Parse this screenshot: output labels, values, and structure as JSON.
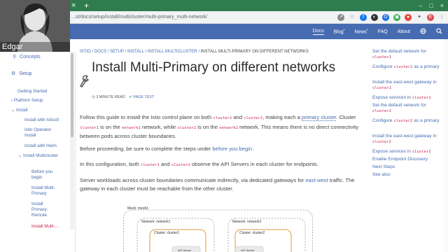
{
  "browser": {
    "url": "...st/docs/setup/install/multicluster/multi-primary_multi-network/",
    "tab_close": "×",
    "tab_new": "+",
    "window_controls": [
      "–",
      "□",
      "×"
    ]
  },
  "webcam": {
    "name": "Edgar"
  },
  "header": {
    "nav": [
      {
        "label": "Docs",
        "active": true
      },
      {
        "label": "Blog",
        "sup": "•"
      },
      {
        "label": "News",
        "sup": "•"
      },
      {
        "label": "FAQ"
      },
      {
        "label": "About"
      }
    ],
    "icons": [
      "globe-icon",
      "search-icon"
    ]
  },
  "sidebar": {
    "concepts": "Concepts",
    "setup": "Setup",
    "items": [
      "Getting Started",
      "Platform Setup",
      "Install",
      "Install with Istioctl",
      "Istio Operator Install",
      "Install with Helm",
      "Install Multicluster",
      "Before you begin",
      "Install Multi-Primary",
      "Install Primary-Remote",
      "Install Multi-..."
    ]
  },
  "breadcrumb": {
    "items": [
      "ISTIO",
      "DOCS",
      "SETUP",
      "INSTALL",
      "INSTALL MULTICLUSTER"
    ],
    "separator": "/",
    "current": "INSTALL MULTI-PRIMARY ON DIFFERENT NETWORKS"
  },
  "page": {
    "title": "Install Multi-Primary on different networks",
    "read_time": "3 MINUTE READ",
    "page_test": "PAGE TEST",
    "p1": {
      "a": "Follow this guide to install the Istio control plane on both ",
      "c1": "cluster1",
      "b": " and ",
      "c2": "cluster2",
      "c": ", making each a ",
      "link": "primary cluster",
      "d": ". Cluster ",
      "c3": "cluster1",
      "e": " is on the ",
      "c4": "network1",
      "f": " network, while ",
      "c5": "cluster2",
      "g": " is on the ",
      "c6": "network2",
      "h": " network. This means there is no direct connectivity between pods across cluster boundaries."
    },
    "p2": {
      "a": "Before proceeding, be sure to complete the steps under ",
      "link": "before you begin",
      "b": "."
    },
    "p3": {
      "a": "In this configuration, both ",
      "c1": "cluster1",
      "b": " and ",
      "c2": "cluster2",
      "c": " observe the API Servers in each cluster for endpoints."
    },
    "p4": {
      "a": "Server workloads across cluster boundaries communicate indirectly, via dedicated gateways for ",
      "link": "east-west",
      "b": " traffic. The gateway in each cluster must be reachable from the other cluster."
    }
  },
  "diagram": {
    "mesh": "Mesh: mesh1",
    "network1": "Network: network1",
    "network2": "Network: network2",
    "cluster1": "Cluster: cluster1",
    "cluster2": "Cluster: cluster2",
    "api1": "API Server",
    "api2": "API Server"
  },
  "toc": [
    {
      "t": "Set the default network for ",
      "c": "cluster1"
    },
    {
      "t": "Configure ",
      "c": "cluster1",
      "t2": " as a primary"
    },
    {
      "t": "Install the east-west gateway in ",
      "c": "cluster1"
    },
    {
      "t": "Expose services in ",
      "c": "cluster1"
    },
    {
      "t": "Set the default network for ",
      "c": "cluster2"
    },
    {
      "t": "Configure ",
      "c": "cluster2",
      "t2": " as a primary"
    },
    {
      "t": "Install the east-west gateway in ",
      "c": "cluster2"
    },
    {
      "t": "Expose services in ",
      "c": "cluster2"
    },
    {
      "t": "Enable Endpoint Discovery"
    },
    {
      "t": "Next Steps"
    },
    {
      "t": "See also"
    }
  ],
  "colors": {
    "brand": "#466bb0",
    "tabbar": "#2f7d4e",
    "code": "#c7254e"
  }
}
